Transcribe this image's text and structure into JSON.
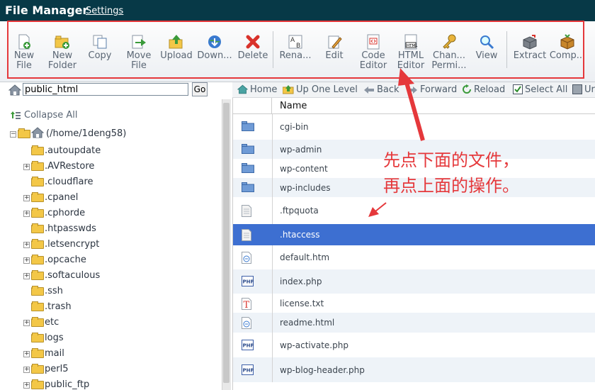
{
  "app": {
    "title": "File Manager",
    "settings_label": "Settings"
  },
  "toolbar": {
    "buttons": [
      {
        "line1": "New",
        "line2": "File",
        "icon": "new-file-icon"
      },
      {
        "line1": "New",
        "line2": "Folder",
        "icon": "new-folder-icon"
      },
      {
        "line1": "Copy",
        "line2": "",
        "icon": "copy-icon"
      },
      {
        "line1": "Move",
        "line2": "File",
        "icon": "move-icon"
      },
      {
        "line1": "Upload",
        "line2": "",
        "icon": "upload-icon"
      },
      {
        "line1": "Down...",
        "line2": "",
        "icon": "download-icon"
      },
      {
        "line1": "Delete",
        "line2": "",
        "icon": "delete-icon"
      },
      {
        "line1": "Rena...",
        "line2": "",
        "icon": "rename-icon"
      },
      {
        "line1": "Edit",
        "line2": "",
        "icon": "edit-icon"
      },
      {
        "line1": "Code",
        "line2": "Editor",
        "icon": "code-editor-icon"
      },
      {
        "line1": "HTML",
        "line2": "Editor",
        "icon": "html-editor-icon"
      },
      {
        "line1": "Chan...",
        "line2": "Permi...",
        "icon": "permissions-icon"
      },
      {
        "line1": "View",
        "line2": "",
        "icon": "view-icon"
      },
      {
        "line1": "Extract",
        "line2": "",
        "icon": "extract-icon"
      },
      {
        "line1": "Comp...",
        "line2": "",
        "icon": "compress-icon"
      }
    ]
  },
  "path": {
    "value": "public_html",
    "go_label": "Go"
  },
  "tree": {
    "collapse_label": "Collapse All",
    "root_label": "(/home/1deng58)",
    "items": [
      {
        "label": ".autoupdate",
        "expandable": false
      },
      {
        "label": ".AVRestore",
        "expandable": true
      },
      {
        "label": ".cloudflare",
        "expandable": false
      },
      {
        "label": ".cpanel",
        "expandable": true
      },
      {
        "label": ".cphorde",
        "expandable": true
      },
      {
        "label": ".htpasswds",
        "expandable": false
      },
      {
        "label": ".letsencrypt",
        "expandable": true
      },
      {
        "label": ".opcache",
        "expandable": true
      },
      {
        "label": ".softaculous",
        "expandable": true
      },
      {
        "label": ".ssh",
        "expandable": false
      },
      {
        "label": ".trash",
        "expandable": false
      },
      {
        "label": "etc",
        "expandable": true
      },
      {
        "label": "logs",
        "expandable": false
      },
      {
        "label": "mail",
        "expandable": true
      },
      {
        "label": "perl5",
        "expandable": true
      },
      {
        "label": "public_ftp",
        "expandable": true
      }
    ]
  },
  "nav": {
    "home": "Home",
    "up_one_level": "Up One Level",
    "back": "Back",
    "forward": "Forward",
    "reload": "Reload",
    "select_all": "Select All",
    "unselect": "Ur"
  },
  "table": {
    "name_header": "Name",
    "rows": [
      {
        "name": "cgi-bin",
        "type": "folder"
      },
      {
        "name": "wp-admin",
        "type": "folder"
      },
      {
        "name": "wp-content",
        "type": "folder"
      },
      {
        "name": "wp-includes",
        "type": "folder"
      },
      {
        "name": ".ftpquota",
        "type": "file"
      },
      {
        "name": ".htaccess",
        "type": "file",
        "selected": true
      },
      {
        "name": "default.htm",
        "type": "html"
      },
      {
        "name": "index.php",
        "type": "php"
      },
      {
        "name": "license.txt",
        "type": "text"
      },
      {
        "name": "readme.html",
        "type": "html"
      },
      {
        "name": "wp-activate.php",
        "type": "php"
      },
      {
        "name": "wp-blog-header.php",
        "type": "php"
      }
    ]
  },
  "annotation": {
    "line1": "先点下面的文件，",
    "line2": "再点上面的操作。",
    "color": "#e5383b"
  }
}
